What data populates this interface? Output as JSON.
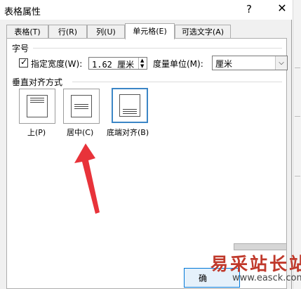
{
  "dialog": {
    "title": "表格属性",
    "help": "?",
    "close": "✕"
  },
  "tabs": [
    {
      "label": "表格(T)"
    },
    {
      "label": "行(R)"
    },
    {
      "label": "列(U)"
    },
    {
      "label": "单元格(E)",
      "active": true
    },
    {
      "label": "可选文字(A)"
    }
  ],
  "size_section": {
    "heading": "字号",
    "specify_width_label": "指定宽度(W):",
    "specify_width_checked": true,
    "width_value": "1.62 厘米",
    "unit_label": "度量单位(M):",
    "unit_value": "厘米"
  },
  "vertical_align": {
    "heading": "垂直对齐方式",
    "options": [
      {
        "label": "上(P)"
      },
      {
        "label": "居中(C)"
      },
      {
        "label": "底端对齐(B)",
        "selected": true
      }
    ]
  },
  "buttons": {
    "ok_label": "确"
  },
  "watermark": {
    "text": "易采站长站",
    "url": "www.easck.com"
  },
  "colors": {
    "selected_border": "#3c86c6",
    "arrow": "#e8333a",
    "watermark": "#c0392b"
  }
}
